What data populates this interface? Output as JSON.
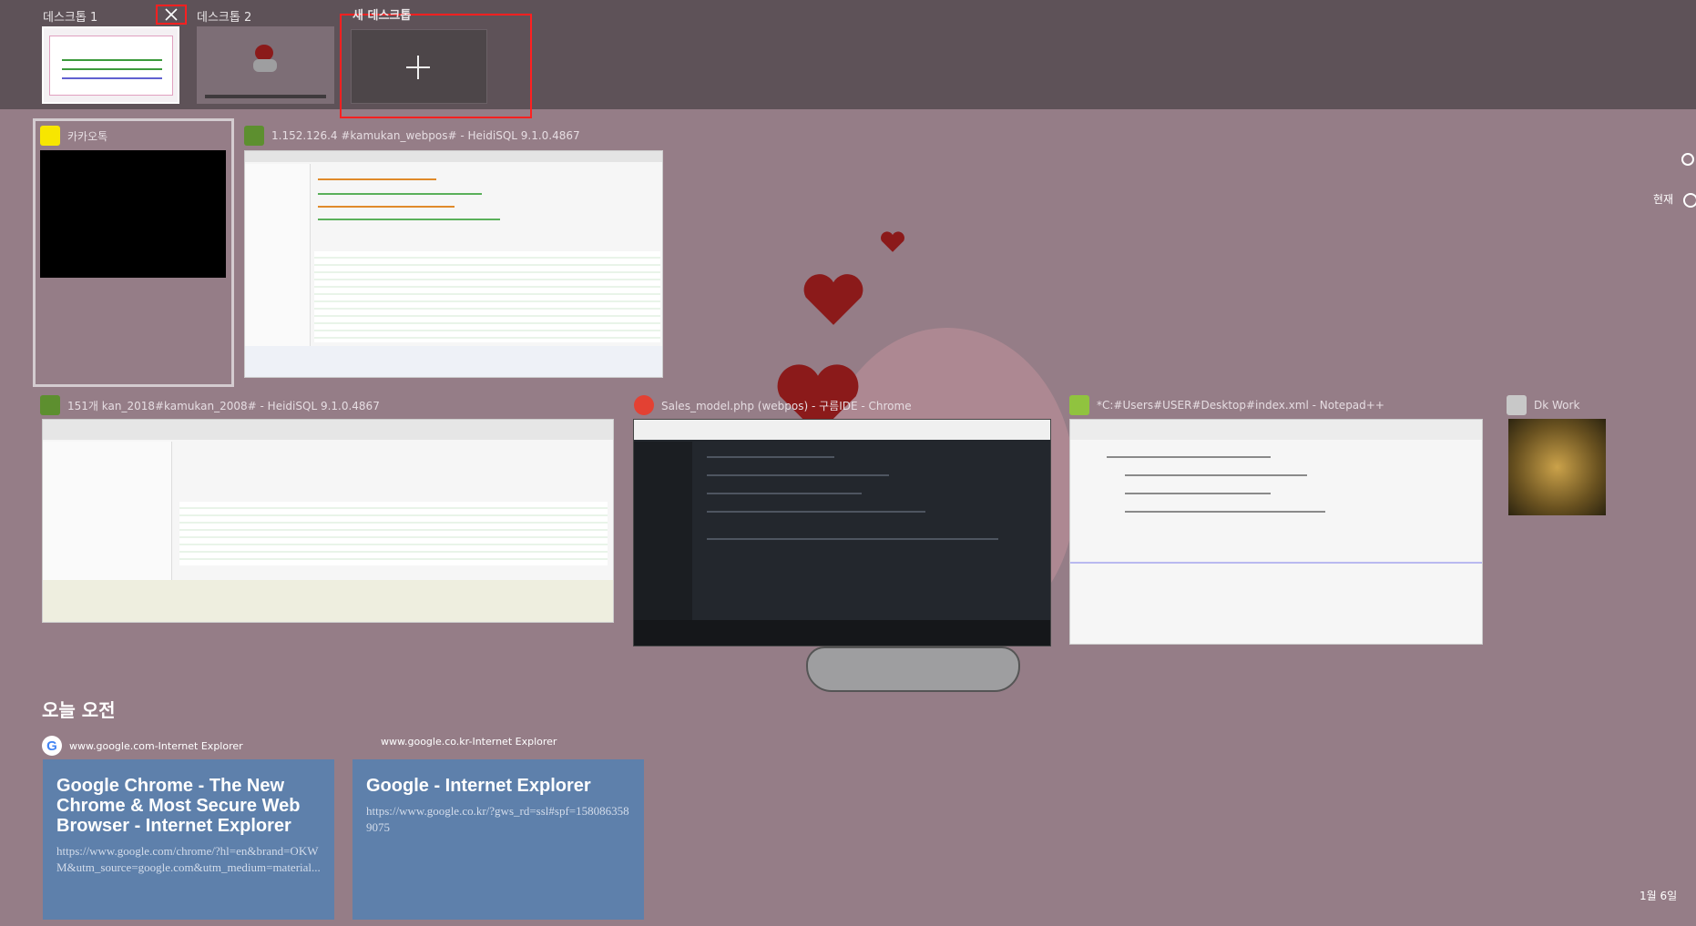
{
  "desktops": [
    {
      "label": "데스크톱 1",
      "close_icon": "close-icon"
    },
    {
      "label": "데스크톱 2"
    },
    {
      "label": "새 데스크톱",
      "plus_icon": "plus-icon"
    }
  ],
  "windows": [
    {
      "title": "카카오톡",
      "icon_color": "#f7e600"
    },
    {
      "title": "1.152.126.4 #kamukan_webpos# - HeidiSQL 9.1.0.4867",
      "icon_color": "#5d8f2f"
    },
    {
      "title": "151개 kan_2018#kamukan_2008# - HeidiSQL 9.1.0.4867",
      "icon_color": "#5d8f2f"
    },
    {
      "title": "Sales_model.php (webpos) - 구름IDE - Chrome",
      "icon_color": "#e34133"
    },
    {
      "title": "*C:#Users#USER#Desktop#index.xml - Notepad++",
      "icon_color": "#90c33f"
    },
    {
      "title": "Dk Work",
      "icon_color": "#c8c8c8"
    }
  ],
  "right_panel": {
    "now_label": "현재",
    "date_label": "1월 6일"
  },
  "timeline": {
    "section_title": "오늘 오전",
    "cards": [
      {
        "source": "www.google.com-Internet Explorer",
        "title": "Google Chrome - The New Chrome & Most Secure Web Browser - Internet Explorer",
        "url": "https://www.google.com/chrome/?hl=en&brand=OKWM&utm_source=google.com&utm_medium=material..."
      },
      {
        "source": "www.google.co.kr-Internet Explorer",
        "title": "Google - Internet Explorer",
        "url": "https://www.google.co.kr/?gws_rd=ssl#spf=1580863589075"
      }
    ]
  },
  "colors": {
    "wallpaper": "#957d87",
    "strip": "#5e5258",
    "highlight": "#ff2020",
    "card": "#5e80ab"
  }
}
